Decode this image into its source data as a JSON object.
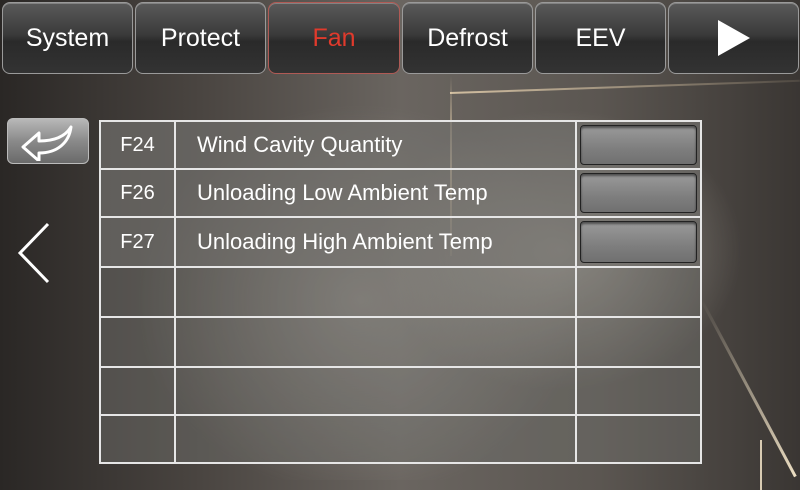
{
  "tabs": [
    {
      "label": "System",
      "active": false
    },
    {
      "label": "Protect",
      "active": false
    },
    {
      "label": "Fan",
      "active": true
    },
    {
      "label": "Defrost",
      "active": false
    },
    {
      "label": "EEV",
      "active": false
    }
  ],
  "next_tab_icon": "play-arrow-icon",
  "back_icon": "undo-arrow-icon",
  "prev_icon": "chevron-left-icon",
  "colors": {
    "active_tab_text": "#e03a2c",
    "text": "#ffffff"
  },
  "params": [
    {
      "code": "F24",
      "name": "Wind Cavity Quantity",
      "value": ""
    },
    {
      "code": "F26",
      "name": "Unloading Low Ambient Temp",
      "value": ""
    },
    {
      "code": "F27",
      "name": "Unloading High Ambient Temp",
      "value": ""
    },
    {
      "code": "",
      "name": "",
      "value": ""
    },
    {
      "code": "",
      "name": "",
      "value": ""
    },
    {
      "code": "",
      "name": "",
      "value": ""
    },
    {
      "code": "",
      "name": "",
      "value": ""
    }
  ]
}
